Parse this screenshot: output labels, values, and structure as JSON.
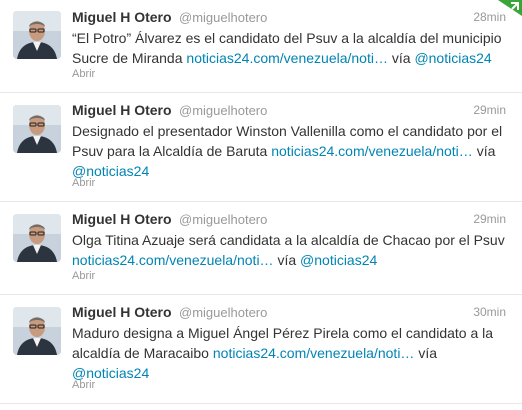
{
  "tweets": [
    {
      "fullname": "Miguel H Otero",
      "username": "@miguelhotero",
      "time": "28min",
      "text": "“El Potro” Álvarez es el candidato del Psuv a la alcaldía del municipio Sucre de Miranda",
      "link": "noticias24.com/venezuela/noti…",
      "via": "vía",
      "mention": "@noticias24",
      "expand": "Abrir"
    },
    {
      "fullname": "Miguel H Otero",
      "username": "@miguelhotero",
      "time": "29min",
      "text": "Designado el presentador Winston Vallenilla como el candidato por el Psuv para la Alcaldía de Baruta",
      "link": "noticias24.com/venezuela/noti…",
      "via": "vía",
      "mention": "@noticias24",
      "expand": "Abrir"
    },
    {
      "fullname": "Miguel H Otero",
      "username": "@miguelhotero",
      "time": "29min",
      "text": "Olga Titina Azuaje será candidata a la alcaldía de Chacao por el Psuv",
      "link": "noticias24.com/venezuela/noti…",
      "via": "vía",
      "mention": "@noticias24",
      "expand": "Abrir"
    },
    {
      "fullname": "Miguel H Otero",
      "username": "@miguelhotero",
      "time": "30min",
      "text": "Maduro designa a Miguel Ángel Pérez Pirela como el candidato a la alcaldía de Maracaibo",
      "link": "noticias24.com/venezuela/noti…",
      "via": "vía",
      "mention": "@noticias24",
      "expand": "Abrir"
    }
  ],
  "colors": {
    "link": "#0084b4",
    "muted": "#999999",
    "text": "#333333",
    "corner": "#3aa63a"
  },
  "icons": {
    "corner": "new-tweets-corner-icon",
    "avatar": "user-avatar-photo"
  }
}
